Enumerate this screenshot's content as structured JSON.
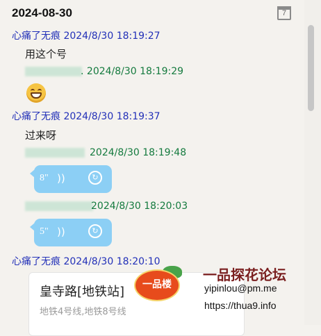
{
  "header": {
    "date": "2024-08-30",
    "calendar_day": "7"
  },
  "messages": [
    {
      "sender": "心痛了无痕",
      "time": "2024/8/30 18:19:27",
      "text": "用这个号"
    },
    {
      "sender_suffix": ".",
      "time": "2024/8/30 18:19:29"
    },
    {
      "sender": "心痛了无痕",
      "time": "2024/8/30 18:19:37",
      "text": "过来呀"
    },
    {
      "time": "2024/8/30 18:19:48",
      "voice_duration": "8\""
    },
    {
      "time": "2024/8/30 18:20:03",
      "voice_duration": "5\""
    },
    {
      "sender": "心痛了无痕",
      "time": "2024/8/30 18:20:10"
    }
  ],
  "location_card": {
    "title": "皇寺路[地铁站]",
    "subtitle": "地铁4号线,地铁8号线"
  },
  "watermark": {
    "logo_text": "一品楼",
    "title": "一品探花论坛",
    "email": "yipinlou@pm.me",
    "url": "https://thua9.info"
  },
  "colors": {
    "other_sender": "#2230b8",
    "self_sender": "#147a3e",
    "voice_bubble": "#8ccff5"
  }
}
